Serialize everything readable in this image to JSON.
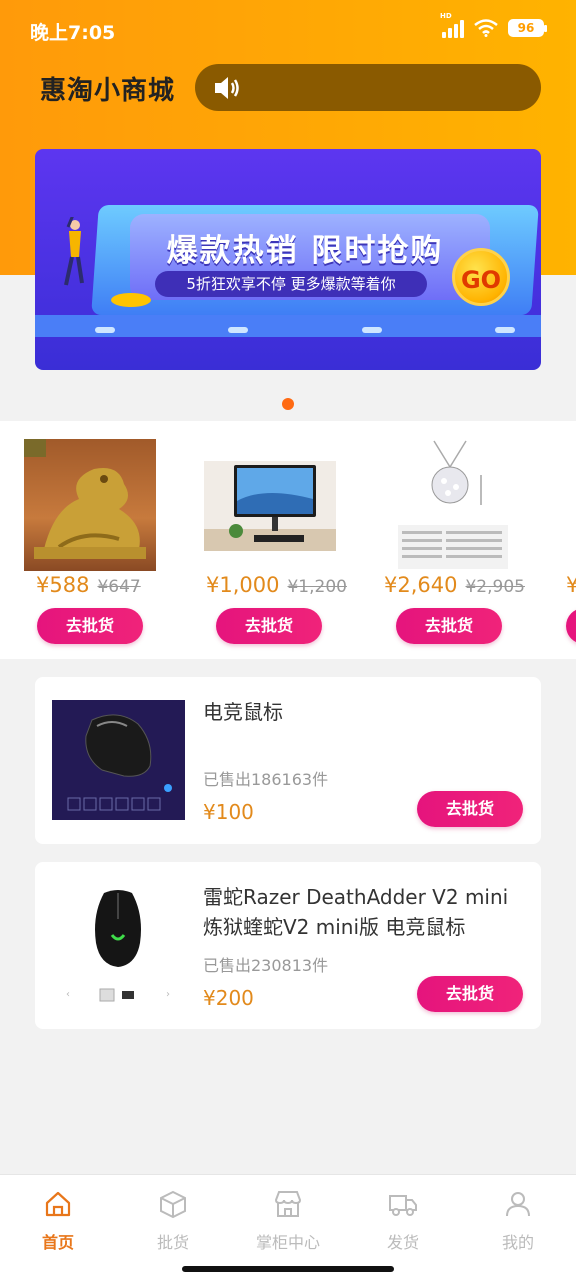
{
  "status_bar": {
    "time": "晚上7:05",
    "network": "HD",
    "battery": "96"
  },
  "header": {
    "logo_text": "惠淘小商城",
    "notice_text": ""
  },
  "banner": {
    "title": "爆款热销 限时抢购",
    "subtitle": "5折狂欢享不停 更多爆款等着你",
    "go_label": "GO",
    "page_count": 1,
    "active_page": 1
  },
  "featured": [
    {
      "price": "¥588",
      "old_price": "¥647",
      "button": "去批货",
      "image": "gold-dragon-statue"
    },
    {
      "price": "¥1,000",
      "old_price": "¥1,200",
      "button": "去批货",
      "image": "computer-monitor"
    },
    {
      "price": "¥2,640",
      "old_price": "¥2,905",
      "button": "去批货",
      "image": "diamond-pendant"
    },
    {
      "price": "¥",
      "old_price": "",
      "button": "",
      "image": ""
    }
  ],
  "products": [
    {
      "title": "电竞鼠标",
      "sold": "已售出186163件",
      "price": "¥100",
      "button": "去批货",
      "image": "gaming-mouse-dark"
    },
    {
      "title": "雷蛇Razer DeathAdder V2 mini 炼狱蝰蛇V2 mini版 电竞鼠标",
      "sold": "已售出230813件",
      "price": "¥200",
      "button": "去批货",
      "image": "razer-mouse"
    }
  ],
  "tabbar": [
    {
      "label": "首页",
      "icon": "home-icon",
      "active": true
    },
    {
      "label": "批货",
      "icon": "box-icon",
      "active": false
    },
    {
      "label": "掌柜中心",
      "icon": "store-icon",
      "active": false
    },
    {
      "label": "发货",
      "icon": "truck-icon",
      "active": false
    },
    {
      "label": "我的",
      "icon": "user-icon",
      "active": false
    }
  ],
  "colors": {
    "accent": "#e8761a",
    "header_orange": "#ffa300",
    "button_pink": "#e5147d",
    "price": "#e28a1c"
  }
}
